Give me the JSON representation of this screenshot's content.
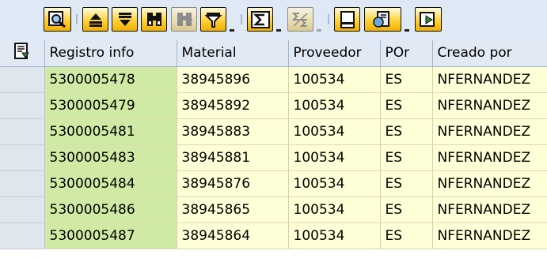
{
  "toolbar": {
    "buttons": [
      {
        "name": "details-button",
        "icon": "magnifier-icon",
        "enabled": true
      },
      {
        "name": "sort-ascending-button",
        "icon": "sort-ascending-icon",
        "enabled": true
      },
      {
        "name": "sort-descending-button",
        "icon": "sort-descending-icon",
        "enabled": true
      },
      {
        "name": "find-button",
        "icon": "binoculars-icon",
        "enabled": true
      },
      {
        "name": "find-next-button",
        "icon": "binoculars-next-icon",
        "enabled": false
      },
      {
        "name": "filter-button",
        "icon": "funnel-icon",
        "enabled": true
      },
      {
        "name": "total-button",
        "icon": "sigma-icon",
        "enabled": true
      },
      {
        "name": "subtotal-button",
        "icon": "subtotal-icon",
        "enabled": false
      },
      {
        "name": "print-preview-button",
        "icon": "print-preview-icon",
        "enabled": true
      },
      {
        "name": "export-button",
        "icon": "export-icon",
        "enabled": true
      },
      {
        "name": "layout-button",
        "icon": "layout-icon",
        "enabled": true
      }
    ]
  },
  "grid": {
    "columns": [
      "Registro info",
      "Material",
      "Proveedor",
      "POr",
      "Creado por"
    ],
    "rows": [
      [
        "5300005478",
        "38945896",
        "100534",
        "ES",
        "NFERNANDEZ"
      ],
      [
        "5300005479",
        "38945892",
        "100534",
        "ES",
        "NFERNANDEZ"
      ],
      [
        "5300005481",
        "38945883",
        "100534",
        "ES",
        "NFERNANDEZ"
      ],
      [
        "5300005483",
        "38945881",
        "100534",
        "ES",
        "NFERNANDEZ"
      ],
      [
        "5300005484",
        "38945876",
        "100534",
        "ES",
        "NFERNANDEZ"
      ],
      [
        "5300005486",
        "38945865",
        "100534",
        "ES",
        "NFERNANDEZ"
      ],
      [
        "5300005487",
        "38945864",
        "100534",
        "ES",
        "NFERNANDEZ"
      ]
    ]
  },
  "colors": {
    "toolbar_bg": "#dfe9f5",
    "header_bg": "#e1e9f4",
    "key_column_bg": "#cfeaa5",
    "cell_bg": "#fefed7",
    "row_selector_bg": "#dfe6ee",
    "button_yellow": "#ffd23a"
  }
}
